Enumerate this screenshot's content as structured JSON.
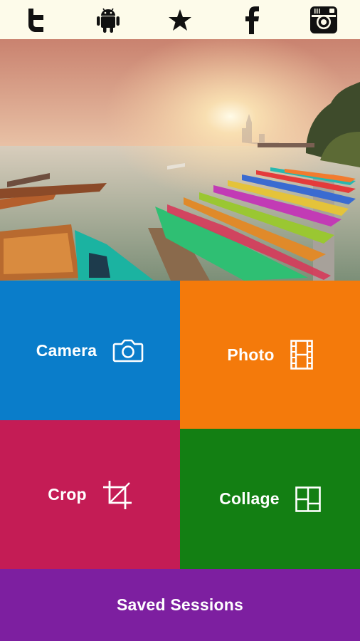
{
  "topbar": {
    "icons": [
      "twitter-icon",
      "android-icon",
      "star-icon",
      "facebook-icon",
      "instagram-icon"
    ]
  },
  "tiles": {
    "camera": {
      "label": "Camera",
      "color": "#0a7dca",
      "icon": "camera-icon"
    },
    "photo": {
      "label": "Photo",
      "color": "#f47a0b",
      "icon": "film-strip-icon"
    },
    "crop": {
      "label": "Crop",
      "color": "#c41c55",
      "icon": "crop-icon"
    },
    "collage": {
      "label": "Collage",
      "color": "#137f13",
      "icon": "collage-icon"
    },
    "saved": {
      "label": "Saved Sessions",
      "color": "#7d1fa0"
    }
  },
  "colors": {
    "topbar_bg": "#fdfbea",
    "icon_color": "#111111"
  }
}
